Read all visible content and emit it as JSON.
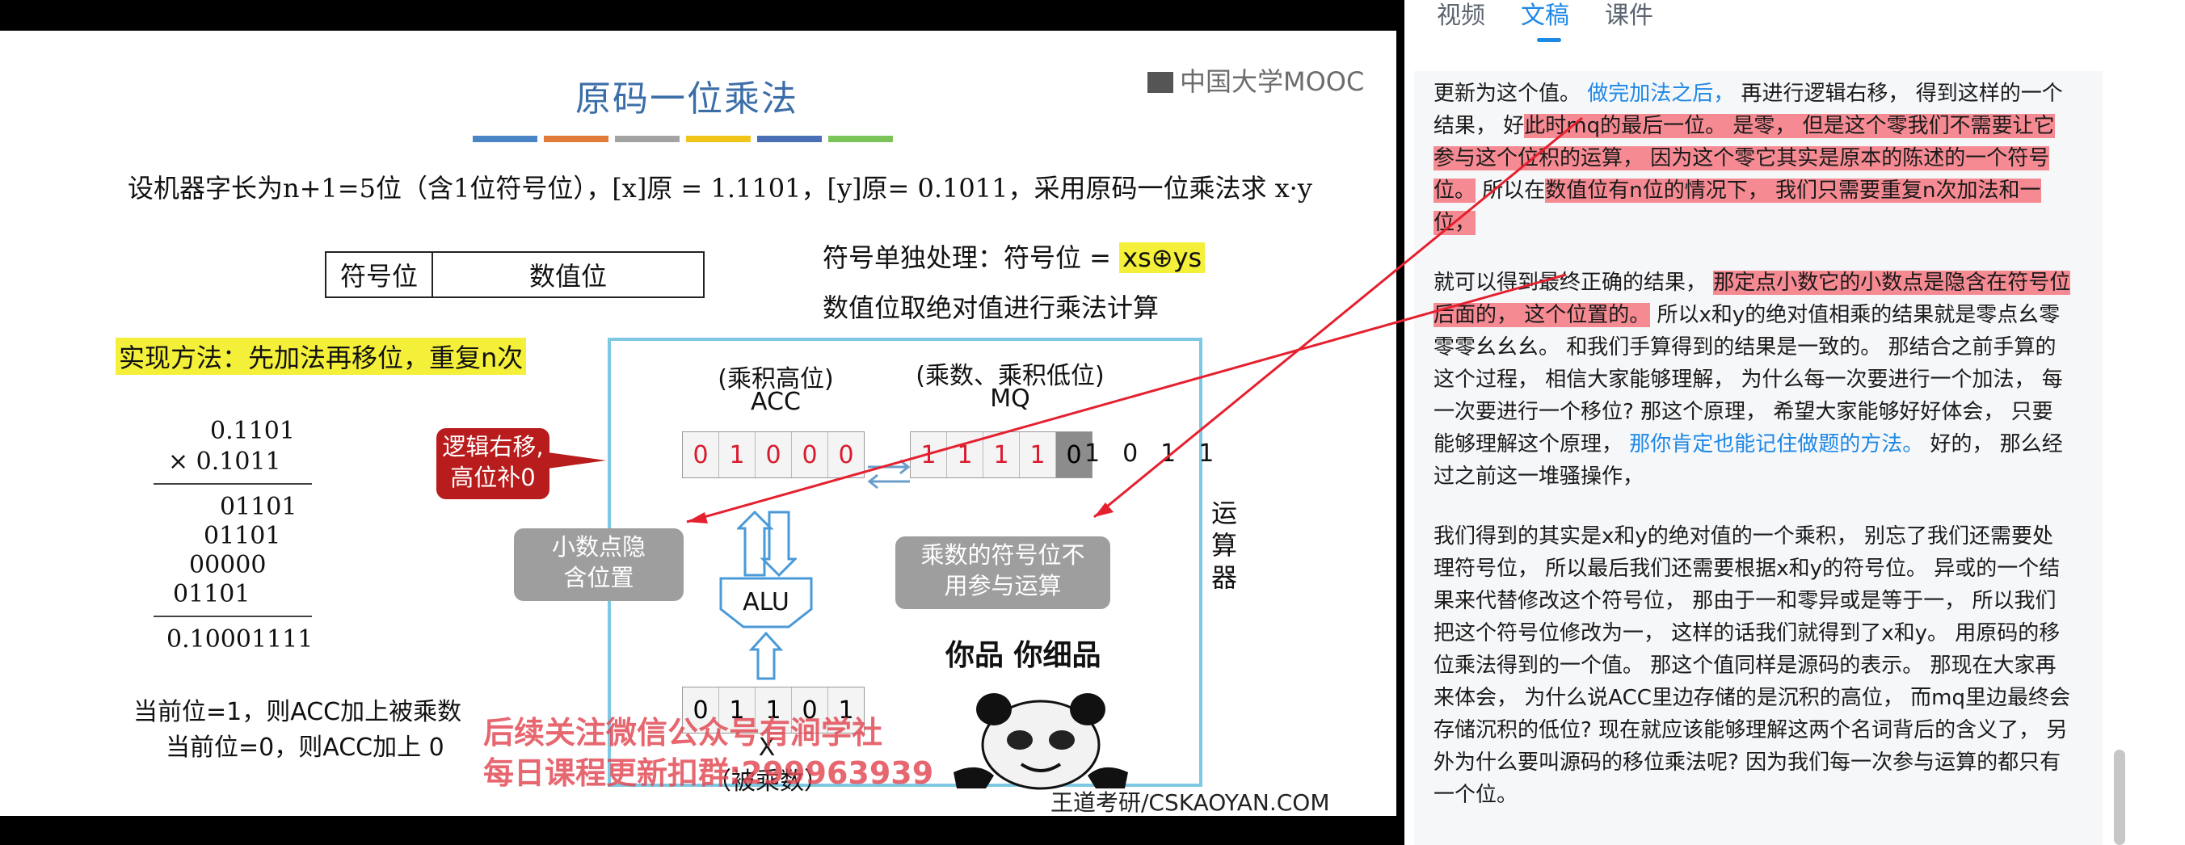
{
  "slide": {
    "title": "原码一位乘法",
    "logo": "中国大学MOOC",
    "stripe_colors": [
      "#4a86c5",
      "#e07b3a",
      "#a3a3a3",
      "#f0c419",
      "#4a6fb5",
      "#7cc35a"
    ],
    "problem": "设机器字长为n+1=5位（含1位符号位），[x]原 = 1.1101，[y]原= 0.1011，采用原码一位乘法求 x·y",
    "sign_box": {
      "sign": "符号位",
      "value": "数值位"
    },
    "sign_rule_prefix": "符号单独处理：符号位 = ",
    "sign_formula": "xs⊕ys",
    "abs_rule": "数值位取绝对值进行乘法计算",
    "method": "实现方法：先加法再移位，重复n次",
    "calc": {
      "multiplicand": "0.1101",
      "multiplier": "×   0.1011",
      "p1": "01101",
      "p2": "01101",
      "p3": "00000",
      "p4": "01101",
      "result": "0.10001111"
    },
    "note1": "当前位=1，则ACC加上被乘数",
    "note2": "当前位=0，则ACC加上 0",
    "acc_title": "(乘积高位)",
    "acc_name": "ACC",
    "mq_title": "(乘数、乘积低位)",
    "mq_name": "MQ",
    "acc_bits": [
      "0",
      "1",
      "0",
      "0",
      "0"
    ],
    "mq_bits": [
      "1",
      "1",
      "1",
      "1",
      "0"
    ],
    "mq_tail": "1011",
    "x_bits": [
      "0",
      "1",
      "1",
      "0",
      "1"
    ],
    "x_label": "X",
    "x_caption": "（被乘数）",
    "alu": "ALU",
    "cpu_label": "运算器",
    "bubble_red": [
      "逻辑右移,",
      "高位补0"
    ],
    "bubble_grey1": [
      "小数点隐",
      "含位置"
    ],
    "bubble_grey2": [
      "乘数的符号位不",
      "用参与运算"
    ],
    "meme_caption": "你品 你细品",
    "watermark1": "后续关注微信公众号有涧学社",
    "watermark2": "每日课程更新扣群:299963939",
    "source": "王道考研/CSKAOYAN.COM"
  },
  "panel": {
    "tabs": [
      "视频",
      "文稿",
      "课件"
    ],
    "active_tab": "文稿",
    "p1": [
      {
        "t": "更新为这个值。 ",
        "s": ""
      },
      {
        "t": "做完加法之后，",
        "s": "link"
      },
      {
        "t": " 再进行逻辑右移， 得到这样的一个结果， 好",
        "s": ""
      },
      {
        "t": "此时mq的最后一位。 是零， 但是这个零我们不需要让它参与这个位积的运算， 因为这个零它其实是原本的陈述的一个符号位。",
        "s": "hl"
      },
      {
        "t": " 所以在",
        "s": ""
      },
      {
        "t": "数值位有n位的情况下， 我们只需要重复n次加法和一位，",
        "s": "hl"
      }
    ],
    "p2": [
      {
        "t": "就可以得到最终正确的结果， ",
        "s": ""
      },
      {
        "t": "那定点小数它的小数点是隐含在符号位后面的， 这个位置的。",
        "s": "hl"
      },
      {
        "t": " 所以x和y的绝对值相乘的结果就是零点幺零零零幺幺幺。 和我们手算得到的结果是一致的。 那结合之前手算的这个过程， 相信大家能够理解， 为什么每一次要进行一个加法， 每一次要进行一个移位? 那这个原理， 希望大家能够好好体会， 只要能够理解这个原理， ",
        "s": ""
      },
      {
        "t": "那你肯定也能记住做题的方法。",
        "s": "link"
      },
      {
        "t": " 好的， 那么经过之前这一堆骚操作，",
        "s": ""
      }
    ],
    "p3": [
      {
        "t": "我们得到的其实是x和y的绝对值的一个乘积， 别忘了我们还需要处理符号位， 所以最后我们还需要根据x和y的符号位。 异或的一个结果来代替修改这个符号位， 那由于一和零异或是等于一， 所以我们把这个符号位修改为一， 这样的话我们就得到了x和y。 用原码的移位乘法得到的一个值。 那这个值同样是源码的表示。 那现在大家再来体会， 为什么说ACC里边存储的是沉积的高位， 而mq里边最终会存储沉积的低位? 现在就应该能够理解这两个名词背后的含义了， 另外为什么要叫源码的移位乘法呢? 因为我们每一次参与运算的都只有一个位。",
        "s": ""
      }
    ]
  }
}
